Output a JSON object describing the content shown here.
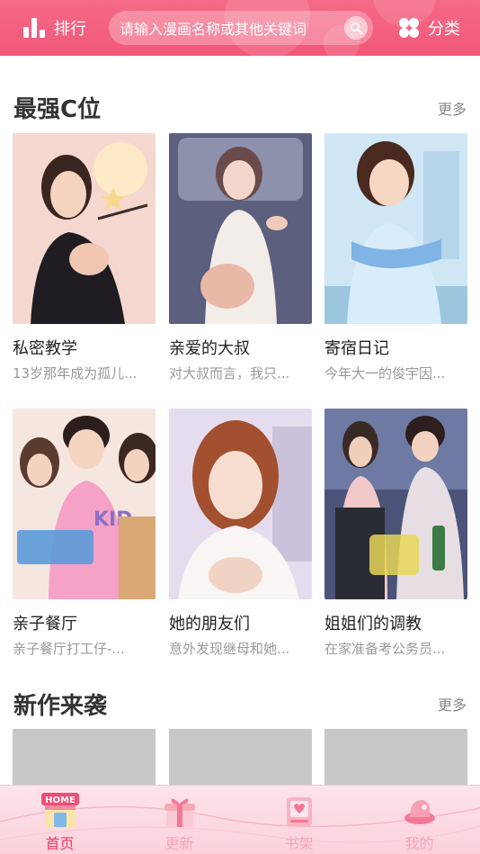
{
  "header": {
    "rank_label": "排行",
    "search_placeholder": "请输入漫画名称或其他关键词",
    "category_label": "分类",
    "accent": "#f2577a"
  },
  "sections": {
    "featured": {
      "title": "最强C位",
      "more": "更多",
      "items": [
        {
          "title": "私密教学",
          "desc": "13岁那年成为孤儿..."
        },
        {
          "title": "亲爱的大叔",
          "desc": "对大叔而言，我只..."
        },
        {
          "title": "寄宿日记",
          "desc": "今年大一的俊宇因..."
        },
        {
          "title": "亲子餐厅",
          "desc": "亲子餐厅打工仔-..."
        },
        {
          "title": "她的朋友们",
          "desc": "意外发现继母和她..."
        },
        {
          "title": "姐姐们的调教",
          "desc": "在家准备考公务员..."
        }
      ]
    },
    "new": {
      "title": "新作来袭",
      "more": "更多"
    }
  },
  "bottom_nav": {
    "items": [
      {
        "label": "首页",
        "icon": "home-icon",
        "badge": "HOME"
      },
      {
        "label": "更新",
        "icon": "gift-icon"
      },
      {
        "label": "书架",
        "icon": "book-icon"
      },
      {
        "label": "我的",
        "icon": "hat-icon"
      }
    ],
    "active_color": "#e83c64",
    "inactive_color": "#f2a6b8"
  }
}
